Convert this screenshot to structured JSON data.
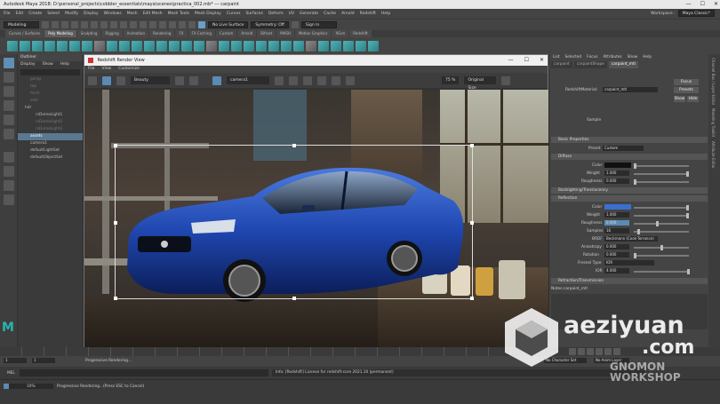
{
  "titlebar": {
    "title": "Autodesk Maya 2018: D:\\personal_projects\\cobbler_essentials\\maya\\scenes\\practica_002.mb* --- carpaint",
    "controls": [
      "—",
      "☐",
      "✕"
    ]
  },
  "menubar": {
    "items": [
      "File",
      "Edit",
      "Create",
      "Select",
      "Modify",
      "Display",
      "Windows",
      "Mesh",
      "Edit Mesh",
      "Mesh Tools",
      "Mesh Display",
      "Curves",
      "Surfaces",
      "Deform",
      "UV",
      "Generate",
      "Cache",
      "Arnold",
      "Redshift",
      "Help"
    ],
    "workspace_label": "Workspace :",
    "workspace_value": "Maya Classic*"
  },
  "statusline": {
    "mode": "Modeling",
    "live_surface": "No Live Surface",
    "symmetry": "Symmetry: Off",
    "signin": "Sign In"
  },
  "shelf_tabs": {
    "items": [
      "Curves / Surfaces",
      "Poly Modeling",
      "Sculpting",
      "Rigging",
      "Animation",
      "Rendering",
      "FX",
      "FX Caching",
      "Custom",
      "Arnold",
      "Bifrost",
      "MASH",
      "Motion Graphics",
      "XGen",
      "Redshift"
    ],
    "active": "Poly Modeling"
  },
  "outliner": {
    "title": "Outliner",
    "menu": [
      "Display",
      "Show",
      "Help"
    ],
    "rows": [
      {
        "label": "persp",
        "dim": true
      },
      {
        "label": "top",
        "dim": true
      },
      {
        "label": "front",
        "dim": true
      },
      {
        "label": "side",
        "dim": true
      },
      {
        "label": "hdr",
        "dim": false
      },
      {
        "label": "rsDomeLight1",
        "dim": false
      },
      {
        "label": "rsDomeLight2",
        "dim": true
      },
      {
        "label": "rsDomeLight3",
        "dim": true
      },
      {
        "label": "assets",
        "dim": false,
        "selected": true
      },
      {
        "label": "camera1",
        "dim": false
      },
      {
        "label": "defaultLightSet",
        "dim": false
      },
      {
        "label": "defaultObjectSet",
        "dim": false
      }
    ]
  },
  "render_view": {
    "title": "Redshift Render View",
    "menu": [
      "File",
      "View",
      "Customize"
    ],
    "aov": "Beauty",
    "camera": "camera1",
    "zoom": "75 %",
    "size": "Original Size"
  },
  "attribute_editor": {
    "menu": [
      "List",
      "Selected",
      "Focus",
      "Attributes",
      "Show",
      "Help"
    ],
    "tabs": [
      "carpaint",
      "carpaintShape",
      "carpaint_mtl"
    ],
    "active_tab": "carpaint_mtl",
    "material_label": "RedshiftMaterial:",
    "material_name": "carpaint_mtl",
    "btn_focus": "Focus",
    "btn_presets": "Presets",
    "btn_show": "Show",
    "btn_hide": "Hide",
    "sample_label": "Sample",
    "sections": {
      "basic": "Basic Properties",
      "diffuse": "Diffuse",
      "backlighting": "Backlighting/Translucency",
      "reflection": "Reflection",
      "refraction": "Refraction/Transmission"
    },
    "preset_label": "Preset",
    "preset_value": "Custom",
    "diffuse": {
      "color_label": "Color",
      "weight_label": "Weight",
      "weight_value": "1.000",
      "roughness_label": "Roughness",
      "roughness_value": "0.000"
    },
    "reflection": {
      "color_label": "Color",
      "weight_label": "Weight",
      "weight_value": "1.000",
      "roughness_label": "Roughness",
      "roughness_value": "0.000",
      "samples_label": "Samples",
      "samples_value": "16",
      "brdf_label": "BRDF",
      "brdf_value": "Beckmann (Cook-Torrance)",
      "aniso_label": "Anisotropy",
      "aniso_value": "0.000",
      "rotation_label": "Rotation",
      "rotation_value": "0.000",
      "fresnel_label": "Fresnel Type",
      "fresnel_value": "IOR",
      "ior_label": "IOR",
      "ior_value": "4.000"
    },
    "notes_label": "Notes:",
    "notes_value": "carpaint_mtl"
  },
  "right_strip": [
    "Channel Box / Layer Editor",
    "Modeling Toolkit",
    "Attribute Editor"
  ],
  "timeline": {
    "start": "1",
    "current": "1",
    "progress_label": "Progressive Rendering...",
    "character_set": "No Character Set",
    "anim_layer": "No Anim Layer"
  },
  "cmdline": {
    "lang": "MEL",
    "message": "Info: [Redshift] License for redshift-core 2021.10 (permanent)"
  },
  "helpline": {
    "percent": "10%",
    "message": "Progressive Rendering...(Press ESC to Cancel)"
  },
  "watermark": {
    "site_main": "aeziyuan",
    "site_tld": ".com",
    "brand": "GNOMON WORKSHOP"
  },
  "colors": {
    "accent": "#5b8ab2",
    "reflection_color": "#3a6fd0",
    "diffuse_color": "#111111",
    "maya_logo": "#2ab4b0"
  }
}
